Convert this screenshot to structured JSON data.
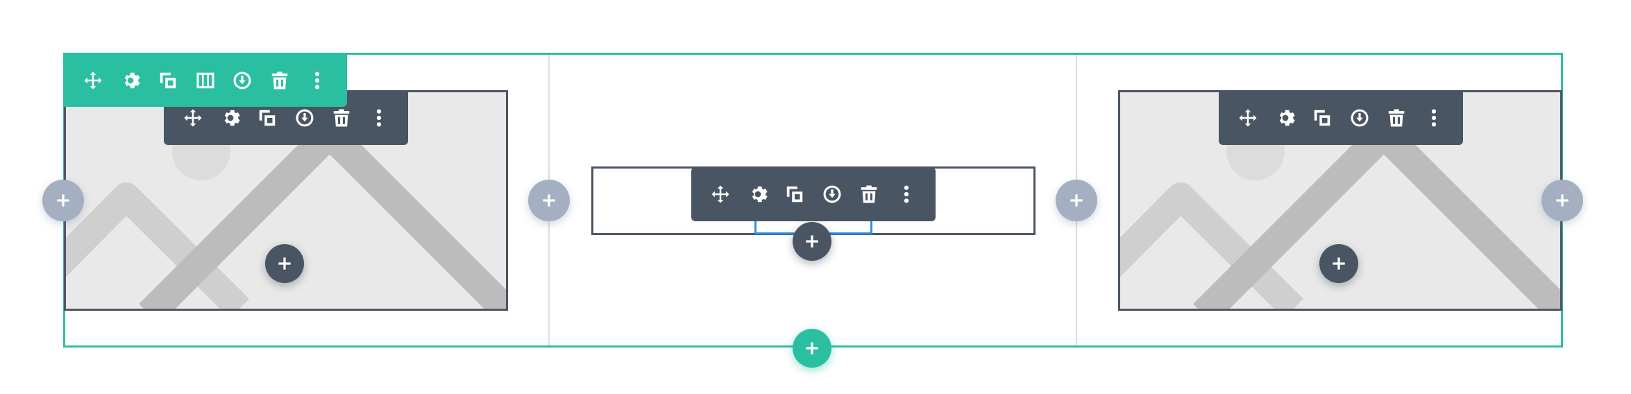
{
  "row": {
    "toolbar_actions": [
      "move",
      "settings",
      "duplicate",
      "columns",
      "save",
      "delete",
      "more"
    ],
    "toolbar_color": "#2bbfa1"
  },
  "columns": [
    {
      "module": "image",
      "module_toolbar_actions": [
        "move",
        "settings",
        "duplicate",
        "save",
        "delete",
        "more"
      ]
    },
    {
      "module": "text",
      "module_toolbar_actions": [
        "move",
        "settings",
        "duplicate",
        "save",
        "delete",
        "more"
      ]
    },
    {
      "module": "image",
      "module_toolbar_actions": [
        "move",
        "settings",
        "duplicate",
        "save",
        "delete",
        "more"
      ]
    }
  ],
  "icons": {
    "move": "move-icon",
    "settings": "gear-icon",
    "duplicate": "duplicate-icon",
    "columns": "columns-icon",
    "save": "save-icon",
    "delete": "trash-icon",
    "more": "more-vertical-icon",
    "add": "plus-icon"
  },
  "colors": {
    "accent": "#2bbfa1",
    "module_toolbar": "#4a5563",
    "add_column": "#a4b0c2",
    "active_outline": "#2e8fe6",
    "placeholder_bg": "#e9e9e9"
  }
}
